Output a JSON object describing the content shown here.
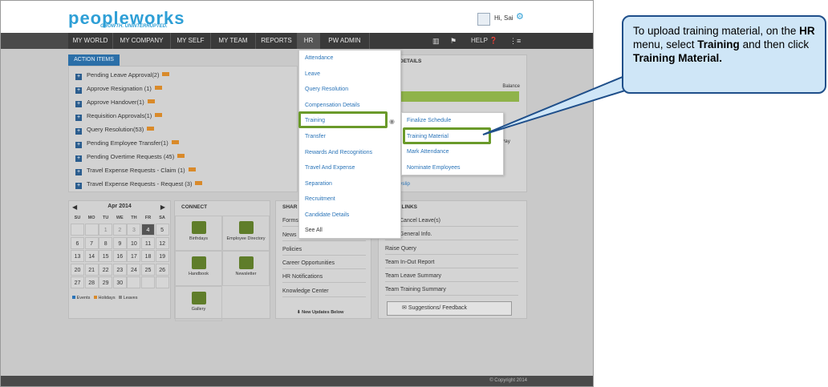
{
  "header": {
    "logo_main": "peopleworks",
    "tagline": "GROWTH. UNINTERRUPTED.",
    "greeting": "Hi, Sai"
  },
  "nav": {
    "items": [
      "MY WORLD",
      "MY COMPANY",
      "MY SELF",
      "MY TEAM",
      "REPORTS",
      "HR",
      "PW ADMIN"
    ],
    "help": "HELP"
  },
  "action_items": {
    "tab": "ACTION ITEMS",
    "rows": [
      "Pending Leave Approval(2)",
      "Approve Resignation (1)",
      "Approve Handover(1)",
      "Requisition Approvals(1)",
      "Query Resolution(53)",
      "Pending Employee Transfer(1)",
      "Pending Overtime Requests (45)",
      "Travel Expense Requests - Claim (1)",
      "Travel Expense Requests - Request (3)"
    ]
  },
  "right_panel": {
    "title": "DETAILS",
    "balance": "Balance",
    "pay": "Pay",
    "payslip": "yslip"
  },
  "calendar": {
    "month": "Apr 2014",
    "days": [
      "SU",
      "MO",
      "TU",
      "WE",
      "TH",
      "FR",
      "SA"
    ],
    "weeks": [
      [
        "",
        "",
        "1",
        "2",
        "3",
        "4",
        "5"
      ],
      [
        "6",
        "7",
        "8",
        "9",
        "10",
        "11",
        "12"
      ],
      [
        "13",
        "14",
        "15",
        "16",
        "17",
        "18",
        "19"
      ],
      [
        "20",
        "21",
        "22",
        "23",
        "24",
        "25",
        "26"
      ],
      [
        "27",
        "28",
        "29",
        "30",
        "",
        "",
        ""
      ]
    ],
    "legend": [
      "Events",
      "Holidays",
      "Leaves"
    ]
  },
  "connect": {
    "title": "CONNECT",
    "tiles": [
      "Birthdays",
      "Employee Directory",
      "Handbook",
      "Newsletter",
      "Gallery"
    ]
  },
  "share": {
    "title": "SHAR",
    "rows": [
      "Forms",
      "News",
      "Policies",
      "Career Opportunities",
      "HR Notifications",
      "Knowledge Center"
    ],
    "updates": "New Updates Below"
  },
  "links": {
    "title": "K LINKS",
    "rows": [
      "Cancel Leave(s)",
      "General Info.",
      "Raise Query",
      "Team In-Out Report",
      "Team Leave Summary",
      "Team Training Summary"
    ],
    "feedback": "Suggestions/ Feedback"
  },
  "hr_menu": {
    "items": [
      "Attendance",
      "Leave",
      "Query Resolution",
      "Compensation Details",
      "Training",
      "Transfer",
      "Rewards And Recognitions",
      "Travel And Expense",
      "Separation",
      "Recruitment",
      "Candidate Details",
      "See All"
    ]
  },
  "training_submenu": {
    "items": [
      "Finalize Schedule",
      "Training Material",
      "Mark Attendance",
      "Nominate Employees"
    ]
  },
  "footer": {
    "copyright": "© Copyright 2014"
  },
  "callout": {
    "t1": "To upload training material, on the ",
    "b1": "HR",
    "t2": " menu, select ",
    "b2": "Training",
    "t3": " and then click ",
    "b3": "Training Material",
    "t4": "."
  },
  "colors": {
    "accent": "#2e9fd6",
    "brand_green": "#8cc63f",
    "highlight": "#6a9a2a",
    "callout_bg": "#cfe6f7"
  }
}
